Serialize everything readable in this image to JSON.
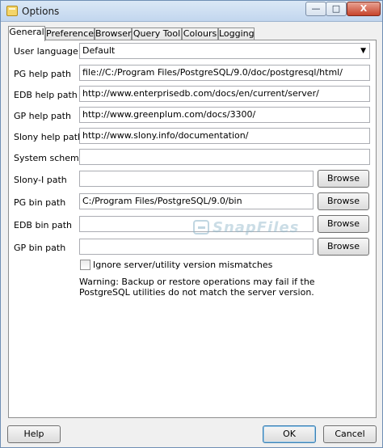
{
  "window": {
    "title": "Options",
    "minimize_glyph": "—",
    "maximize_glyph": "□",
    "close_glyph": "X"
  },
  "tabs": [
    {
      "label": "General"
    },
    {
      "label": "Preferences"
    },
    {
      "label": "Browser"
    },
    {
      "label": "Query Tool"
    },
    {
      "label": "Colours"
    },
    {
      "label": "Logging"
    }
  ],
  "general": {
    "user_language": {
      "label": "User language",
      "value": "Default"
    },
    "pg_help": {
      "label": "PG help path",
      "value": "file://C:/Program Files/PostgreSQL/9.0/doc/postgresql/html/"
    },
    "edb_help": {
      "label": "EDB help path",
      "value": "http://www.enterprisedb.com/docs/en/current/server/"
    },
    "gp_help": {
      "label": "GP help path",
      "value": "http://www.greenplum.com/docs/3300/"
    },
    "slony_help": {
      "label": "Slony help path",
      "value": "http://www.slony.info/documentation/"
    },
    "system_schemas": {
      "label": "System schemas",
      "value": ""
    },
    "slony_path": {
      "label": "Slony-I path",
      "value": ""
    },
    "pg_bin": {
      "label": "PG bin path",
      "value": "C:/Program Files/PostgreSQL/9.0/bin"
    },
    "edb_bin": {
      "label": "EDB bin path",
      "value": ""
    },
    "gp_bin": {
      "label": "GP bin path",
      "value": ""
    },
    "browse_label": "Browse",
    "ignore_mismatch_label": "Ignore server/utility version mismatches",
    "warning": "Warning: Backup or restore operations may fail if the PostgreSQL utilities do not match the server version."
  },
  "watermark": "SnapFiles",
  "buttons": {
    "help": "Help",
    "ok": "OK",
    "cancel": "Cancel"
  }
}
